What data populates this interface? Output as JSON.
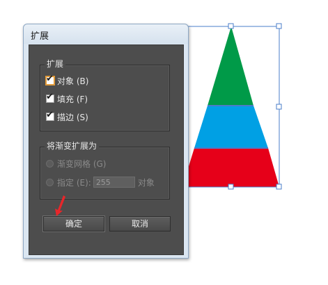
{
  "dialog": {
    "title": "扩展",
    "expand_group": {
      "title": "扩展",
      "options": [
        {
          "label": "对象 (B)",
          "checked": true,
          "focused": true
        },
        {
          "label": "填充 (F)",
          "checked": true,
          "focused": false
        },
        {
          "label": "描边 (S)",
          "checked": true,
          "focused": false
        }
      ]
    },
    "gradient_group": {
      "title": "将渐变扩展为",
      "mesh_label": "渐变网格 (G)",
      "specify_label": "指定 (E):",
      "specify_value": "255",
      "specify_unit": "对象"
    },
    "ok_label": "确定",
    "cancel_label": "取消"
  },
  "artwork": {
    "colors": {
      "top": "#009a48",
      "middle": "#00a0e4",
      "bottom": "#e60019",
      "selection": "#4a7cc9"
    }
  },
  "annotation": {
    "arrow_color": "#e8262a",
    "icon": "red-pointer-arrow-icon"
  }
}
